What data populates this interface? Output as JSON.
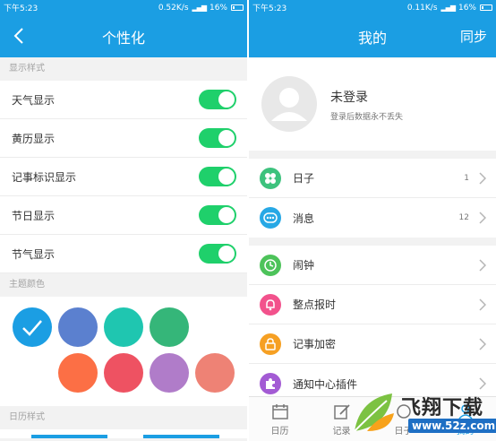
{
  "left": {
    "status": {
      "time": "下午5:23",
      "speed": "0.52K/s",
      "battery": "16%"
    },
    "header": {
      "title": "个性化"
    },
    "display_section": {
      "label": "显示样式",
      "items": [
        {
          "label": "天气显示",
          "on": true
        },
        {
          "label": "黄历显示",
          "on": true
        },
        {
          "label": "记事标识显示",
          "on": true
        },
        {
          "label": "节日显示",
          "on": true
        },
        {
          "label": "节气显示",
          "on": true
        }
      ]
    },
    "theme_section": {
      "label": "主题颜色",
      "colors": [
        "#1b9ee3",
        "#5b80cf",
        "#1fc6b0",
        "#35b679",
        "#fc6f45",
        "#ee5262",
        "#b07cc9",
        "#ee8275"
      ],
      "selected": 0
    },
    "calendar_section": {
      "label": "日历样式"
    }
  },
  "right": {
    "status": {
      "time": "下午5:23",
      "speed": "0.11K/s",
      "battery": "16%"
    },
    "header": {
      "title": "我的",
      "sync_label": "同步"
    },
    "profile": {
      "title": "未登录",
      "subtitle": "登录后数据永不丢失"
    },
    "menu_group1": [
      {
        "label": "日子",
        "count": "1",
        "color": "#3dc27d",
        "icon": "clover-icon"
      },
      {
        "label": "消息",
        "count": "12",
        "color": "#27a8e5",
        "icon": "message-icon"
      }
    ],
    "menu_group2": [
      {
        "label": "闹钟",
        "color": "#4dc35a",
        "icon": "clock-icon"
      },
      {
        "label": "整点报时",
        "color": "#f2528c",
        "icon": "bell-icon"
      },
      {
        "label": "记事加密",
        "color": "#f6a023",
        "icon": "lock-icon"
      },
      {
        "label": "通知中心插件",
        "color": "#a35bd4",
        "icon": "puzzle-icon"
      }
    ],
    "tabs": [
      {
        "label": "日历",
        "icon": "calendar-icon"
      },
      {
        "label": "记录",
        "icon": "edit-icon"
      },
      {
        "label": "日子",
        "icon": "day-icon"
      },
      {
        "label": "我的",
        "icon": "person-icon"
      }
    ],
    "watermark": {
      "title": "飞翔下载",
      "url": "www.52z.com"
    }
  }
}
